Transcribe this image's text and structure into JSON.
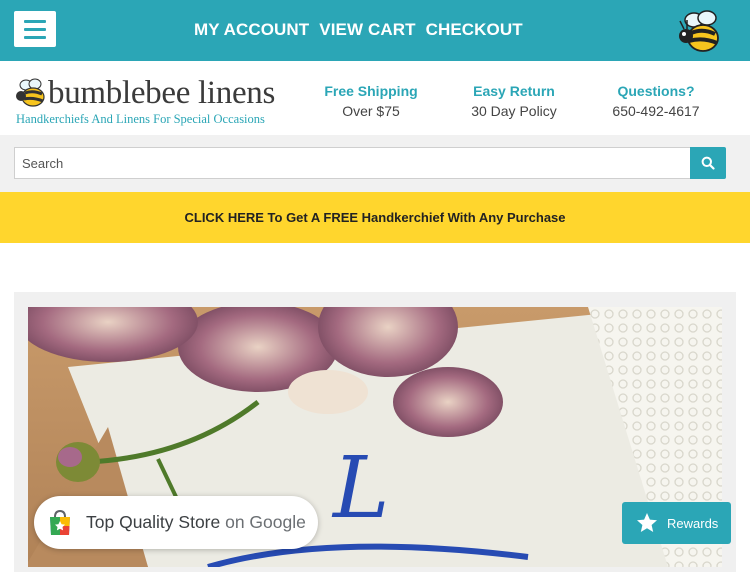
{
  "topbar": {
    "nav": [
      {
        "label": "MY ACCOUNT"
      },
      {
        "label": "VIEW CART"
      },
      {
        "label": "CHECKOUT"
      }
    ]
  },
  "logo": {
    "title": "bumblebee linens",
    "tagline": "Handkerchiefs And Linens For Special Occasions"
  },
  "info": [
    {
      "line1": "Free Shipping",
      "line2": "Over $75"
    },
    {
      "line1": "Easy Return",
      "line2": "30 Day Policy"
    },
    {
      "line1": "Questions?",
      "line2": "650-492-4617"
    }
  ],
  "search": {
    "placeholder": "Search"
  },
  "promo": {
    "text": "CLICK HERE To Get A FREE Handkerchief With Any Purchase"
  },
  "google_badge": {
    "text": "Top Quality Store",
    "suffix": "on Google"
  },
  "rewards": {
    "label": "Rewards"
  },
  "icons": {
    "menu": "hamburger-icon",
    "bee": "bee-icon",
    "search": "search-icon",
    "google_store": "google-shopping-icon",
    "rewards": "star-icon"
  },
  "colors": {
    "brand_teal": "#2ba6b6",
    "promo_yellow": "#ffd62d"
  }
}
